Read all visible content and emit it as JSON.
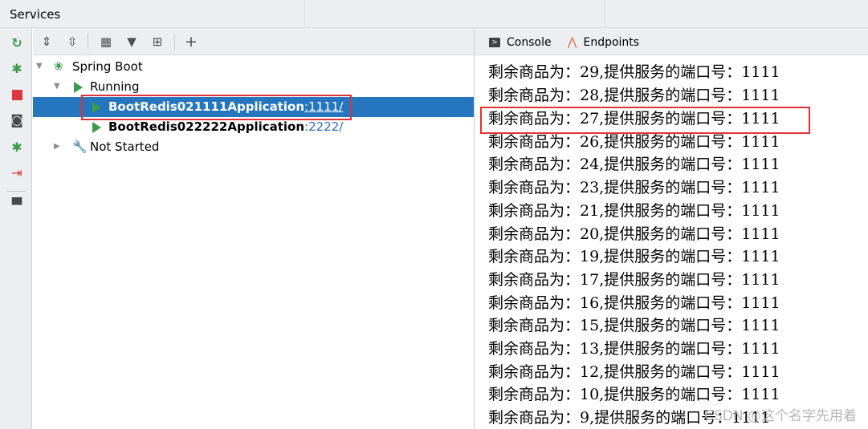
{
  "window": {
    "title": "Services"
  },
  "tree_toolbar": {
    "icons": [
      "expand-all-icon",
      "collapse-all-icon",
      "group-by-icon",
      "filter-icon",
      "add-service-icon",
      "add-icon"
    ]
  },
  "left_toolbar": {
    "icons": [
      "rerun-icon",
      "debug-icon",
      "stop-icon",
      "camera-icon",
      "debug-run-icon",
      "attach-icon",
      "layout-icon"
    ]
  },
  "tree": {
    "spring_boot": "Spring Boot",
    "running": "Running",
    "apps": [
      {
        "name": "BootRedis021111Application",
        "port": ":1111/"
      },
      {
        "name": "BootRedis022222Application",
        "port": ":2222/"
      }
    ],
    "not_started": "Not Started"
  },
  "tabs": {
    "console": "Console",
    "endpoints": "Endpoints"
  },
  "console": {
    "lines": [
      "剩余商品为：29,提供服务的端口号：1111",
      "剩余商品为：28,提供服务的端口号：1111",
      "剩余商品为：27,提供服务的端口号：1111",
      "剩余商品为：26,提供服务的端口号：1111",
      "剩余商品为：24,提供服务的端口号：1111",
      "剩余商品为：23,提供服务的端口号：1111",
      "剩余商品为：21,提供服务的端口号：1111",
      "剩余商品为：20,提供服务的端口号：1111",
      "剩余商品为：19,提供服务的端口号：1111",
      "剩余商品为：17,提供服务的端口号：1111",
      "剩余商品为：16,提供服务的端口号：1111",
      "剩余商品为：15,提供服务的端口号：1111",
      "剩余商品为：13,提供服务的端口号：1111",
      "剩余商品为：12,提供服务的端口号：1111",
      "剩余商品为：10,提供服务的端口号：1111",
      "剩余商品为：9,提供服务的端口号：1111"
    ]
  },
  "watermark": "CSDN @这个名字先用着",
  "colors": {
    "selection": "#2675bf",
    "highlight_box": "#e0323a",
    "run_green": "#3c9b4a",
    "port_blue": "#2a6ebb"
  }
}
